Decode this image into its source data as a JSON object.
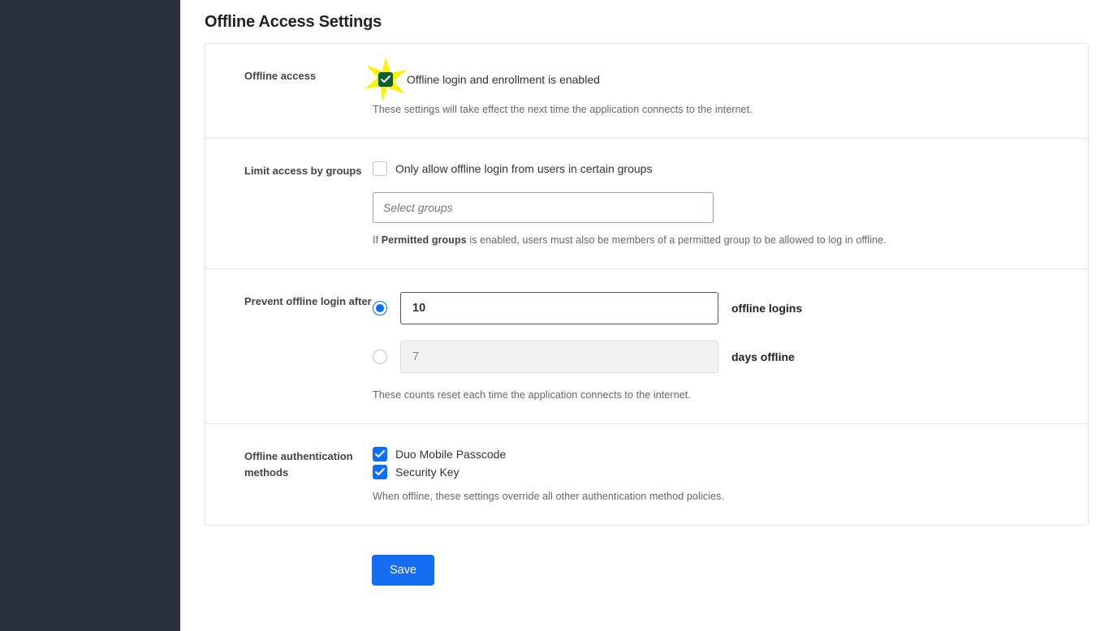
{
  "page_title": "Offline Access Settings",
  "section1": {
    "label": "Offline access",
    "checkbox_label": "Offline login and enrollment is enabled",
    "helper": "These settings will take effect the next time the application connects to the internet."
  },
  "section2": {
    "label": "Limit access by groups",
    "checkbox_label": "Only allow offline login from users in certain groups",
    "placeholder": "Select groups",
    "helper_prefix": "If ",
    "helper_bold": "Permitted groups",
    "helper_suffix": " is enabled, users must also be members of a permitted group to be allowed to log in offline."
  },
  "section3": {
    "label": "Prevent offline login after",
    "logins_value": "10",
    "logins_suffix": "offline logins",
    "days_value": "7",
    "days_suffix": "days offline",
    "helper": "These counts reset each time the application connects to the internet."
  },
  "section4": {
    "label": "Offline authentication methods",
    "opt1": "Duo Mobile Passcode",
    "opt2": "Security Key",
    "helper": "When offline, these settings override all other authentication method policies."
  },
  "save_label": "Save"
}
